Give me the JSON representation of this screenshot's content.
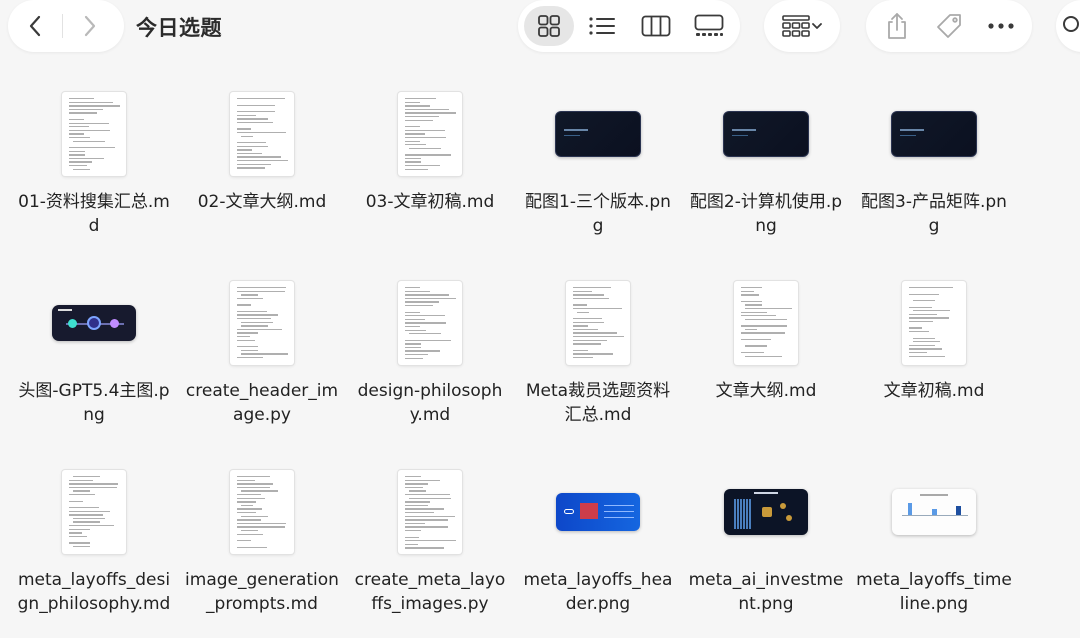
{
  "toolbar": {
    "title": "今日选题",
    "back_icon": "chevron-left-icon",
    "forward_icon": "chevron-right-icon",
    "view_modes": [
      "icon-grid-view",
      "list-view",
      "column-view",
      "gallery-view"
    ],
    "group_icon": "group-by-icon",
    "share_icon": "share-icon",
    "tag_icon": "tag-icon",
    "more_icon": "more-icon"
  },
  "files": [
    {
      "name": "01-资料搜集汇总.md",
      "kind": "doc"
    },
    {
      "name": "02-文章大纲.md",
      "kind": "doc"
    },
    {
      "name": "03-文章初稿.md",
      "kind": "doc"
    },
    {
      "name": "配图1-三个版本.png",
      "kind": "dark-card"
    },
    {
      "name": "配图2-计算机使用.png",
      "kind": "dark-card"
    },
    {
      "name": "配图3-产品矩阵.png",
      "kind": "dark-card"
    },
    {
      "name": "头图-GPT5.4主图.png",
      "kind": "gpt-header"
    },
    {
      "name": "create_header_image.py",
      "kind": "doc"
    },
    {
      "name": "design-philosophy.md",
      "kind": "doc"
    },
    {
      "name": "Meta裁员选题资料汇总.md",
      "kind": "doc"
    },
    {
      "name": "文章大纲.md",
      "kind": "doc"
    },
    {
      "name": "文章初稿.md",
      "kind": "doc"
    },
    {
      "name": "meta_layoffs_design_philosophy.md",
      "kind": "doc"
    },
    {
      "name": "image_generation_prompts.md",
      "kind": "doc"
    },
    {
      "name": "create_meta_layoffs_images.py",
      "kind": "doc"
    },
    {
      "name": "meta_layoffs_header.png",
      "kind": "blue-header"
    },
    {
      "name": "meta_ai_investment.png",
      "kind": "dark-chart"
    },
    {
      "name": "meta_layoffs_timeline.png",
      "kind": "light-chart"
    }
  ],
  "colors": {
    "background": "#f6f6f6",
    "toolbar": "#ffffff",
    "selected_view": "#e6e6e6",
    "icon": "#3a3a3a"
  }
}
